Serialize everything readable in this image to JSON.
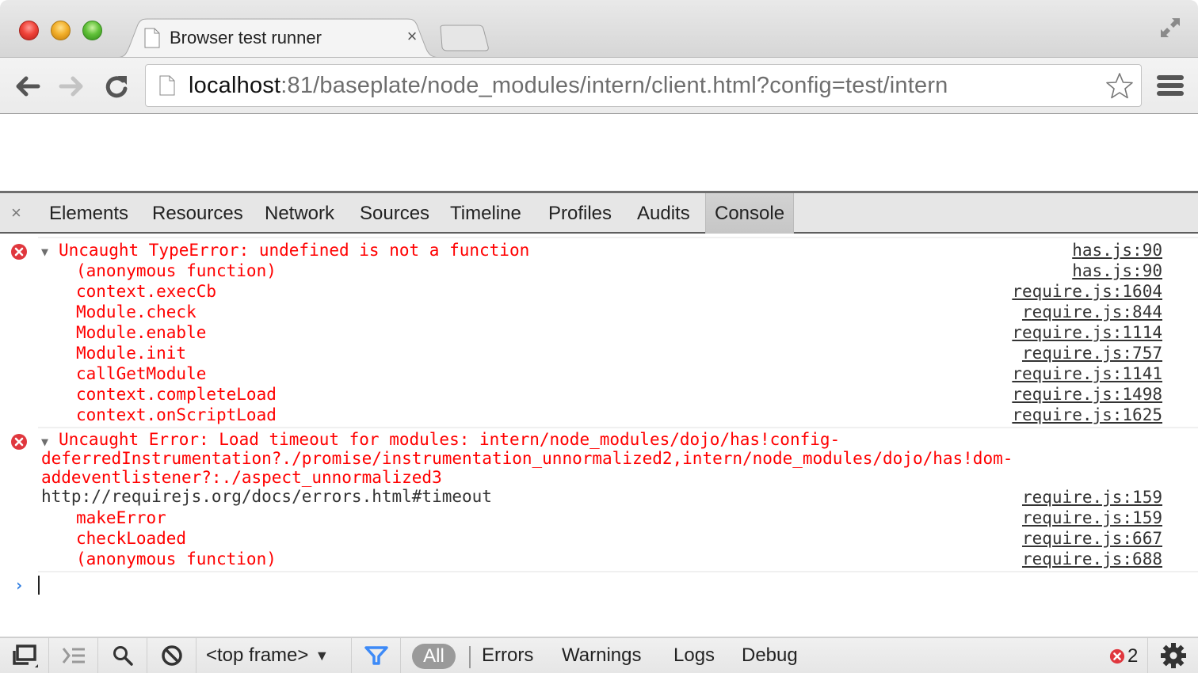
{
  "browser": {
    "tab_title": "Browser test runner",
    "tab_close": "×",
    "url_host": "localhost",
    "url_rest": ":81/baseplate/node_modules/intern/client.html?config=test/intern"
  },
  "devtools": {
    "close": "×",
    "tabs": [
      {
        "label": "Elements",
        "active": false
      },
      {
        "label": "Resources",
        "active": false
      },
      {
        "label": "Network",
        "active": false
      },
      {
        "label": "Sources",
        "active": false
      },
      {
        "label": "Timeline",
        "active": false
      },
      {
        "label": "Profiles",
        "active": false
      },
      {
        "label": "Audits",
        "active": false
      },
      {
        "label": "Console",
        "active": true
      }
    ]
  },
  "console": {
    "messages": [
      {
        "header": "Uncaught TypeError: undefined is not a function",
        "header_source": "has.js:90",
        "stack": [
          {
            "fn": "(anonymous function)",
            "source": "has.js:90"
          },
          {
            "fn": "context.execCb",
            "source": "require.js:1604"
          },
          {
            "fn": "Module.check",
            "source": "require.js:844"
          },
          {
            "fn": "Module.enable",
            "source": "require.js:1114"
          },
          {
            "fn": "Module.init",
            "source": "require.js:757"
          },
          {
            "fn": "callGetModule",
            "source": "require.js:1141"
          },
          {
            "fn": "context.completeLoad",
            "source": "require.js:1498"
          },
          {
            "fn": "context.onScriptLoad",
            "source": "require.js:1625"
          }
        ]
      },
      {
        "header_lines": [
          "Uncaught Error: Load timeout for modules: intern/node_modules/dojo/has!config-",
          "deferredInstrumentation?./promise/instrumentation_unnormalized2,intern/node_modules/dojo/has!dom-",
          "addeventlistener?:./aspect_unnormalized3"
        ],
        "url_line": "http://requirejs.org/docs/errors.html#timeout",
        "url_source": "require.js:159",
        "stack": [
          {
            "fn": "makeError",
            "source": "require.js:159"
          },
          {
            "fn": "checkLoaded",
            "source": "require.js:667"
          },
          {
            "fn": "(anonymous function)",
            "source": "require.js:688"
          }
        ]
      }
    ],
    "prompt": "›"
  },
  "statusbar": {
    "frame_select": "<top frame>",
    "filters": {
      "all": "All",
      "errors": "Errors",
      "warnings": "Warnings",
      "logs": "Logs",
      "debug": "Debug"
    },
    "error_count": "2"
  },
  "colors": {
    "error_red": "#ff0000",
    "error_icon": "#e0373e",
    "prompt_blue": "#2a7ae0",
    "filter_blue": "#3d8af7"
  }
}
